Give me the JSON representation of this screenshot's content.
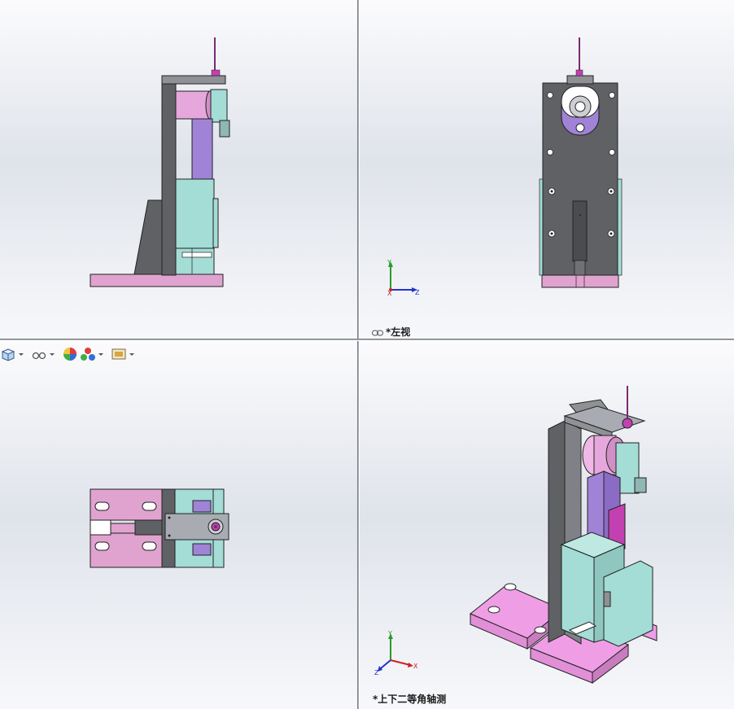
{
  "views": {
    "top_left": {
      "label": ""
    },
    "top_right": {
      "label": "*左视"
    },
    "bottom_left": {
      "label": ""
    },
    "bottom_right": {
      "label": "*上下二等角轴测"
    }
  },
  "triad": {
    "x": "X",
    "y": "Y",
    "z": "Z"
  },
  "toolbar": {
    "icons": [
      "view-orientation-icon",
      "hide-show-items-icon",
      "edit-appearance-icon",
      "apply-scene-icon",
      "view-settings-icon"
    ]
  },
  "colors": {
    "pink": "#e0a3cf",
    "gray": "#5f6164",
    "cyan": "#a4dcd6",
    "purple": "#a083d6",
    "magenta": "#c340b2"
  }
}
